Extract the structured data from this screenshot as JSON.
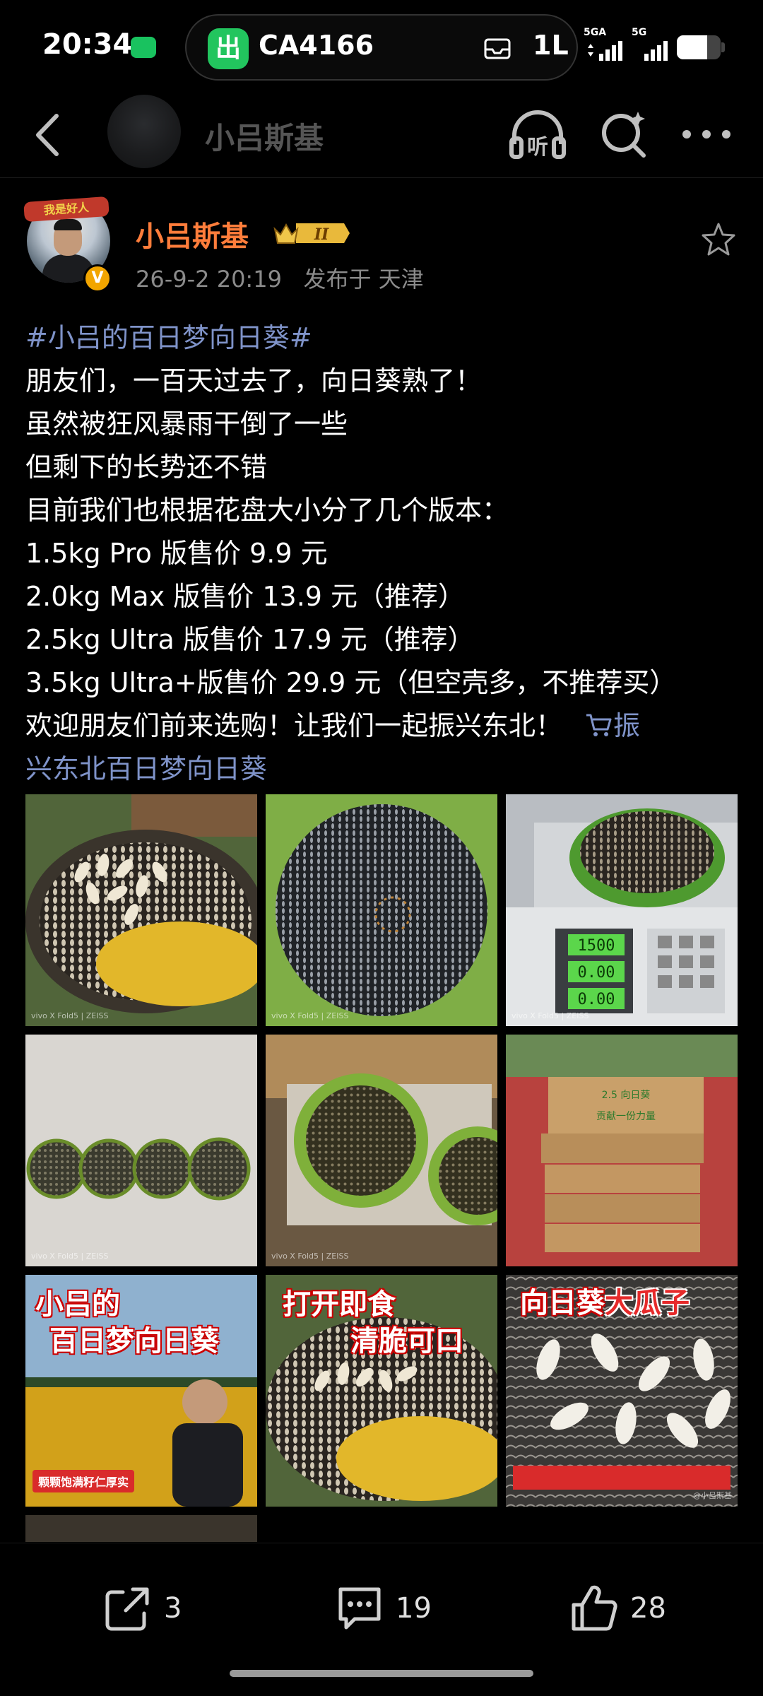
{
  "status_bar": {
    "time": "20:34",
    "flight_app_badge": "出",
    "flight_number": "CA4166",
    "luggage_lane": "1L",
    "network_1": "5GA",
    "network_2": "5G",
    "battery_level": 0.7
  },
  "nav": {
    "user_name": "小吕斯基",
    "icons": [
      "back-icon",
      "listen-icon",
      "search-icon",
      "more-icon"
    ]
  },
  "post": {
    "author_name": "小吕斯基",
    "avatar_ribbon": "我是好人",
    "badge_level": "II",
    "timestamp": "26-9-2 20:19",
    "location": "发布于 天津",
    "hashtag": "#小吕的百日梦向日葵#",
    "lines": [
      "朋友们，一百天过去了，向日葵熟了！",
      "虽然被狂风暴雨干倒了一些",
      "但剩下的长势还不错",
      "目前我们也根据花盘大小分了几个版本：",
      "1.5kg Pro 版售价 9.9 元",
      "2.0kg Max 版售价 13.9 元（推荐）",
      "2.5kg Ultra 版售价 17.9 元（推荐）",
      "3.5kg Ultra+版售价 29.9 元（但空壳多，不推荐买）",
      "欢迎朋友们前来选购！让我们一起振兴东北！"
    ],
    "shop_link_part1": "振",
    "shop_link_part2": "兴东北百日梦向日葵"
  },
  "images": {
    "scale_readings": [
      "1500",
      "0.00",
      "0.00"
    ],
    "tile_captions": [
      "vivo X Fold5 | ZEISS",
      "vivo X Fold5 | ZEISS",
      "vivo X Fold5 | ZEISS",
      "vivo X Fold5 | ZEISS",
      "vivo X Fold5 | ZEISS"
    ],
    "box_text_1": "2.5 向日葵",
    "box_text_2": "贡献一份力量",
    "tile7_line1": "小吕的",
    "tile7_line2": "百日梦向日葵",
    "tile7_banner": "颗颗饱满籽仁厚实",
    "tile8_line1": "打开即食",
    "tile8_line2": "清脆可口",
    "tile9_white": "向日葵",
    "tile9_red": "大瓜子",
    "watermark": "@小吕斯基"
  },
  "actions": {
    "share_count": "3",
    "comment_count": "19",
    "like_count": "28"
  },
  "colors": {
    "accent_name": "#ff7d3b",
    "link": "#7f93c9",
    "background": "#000000"
  }
}
